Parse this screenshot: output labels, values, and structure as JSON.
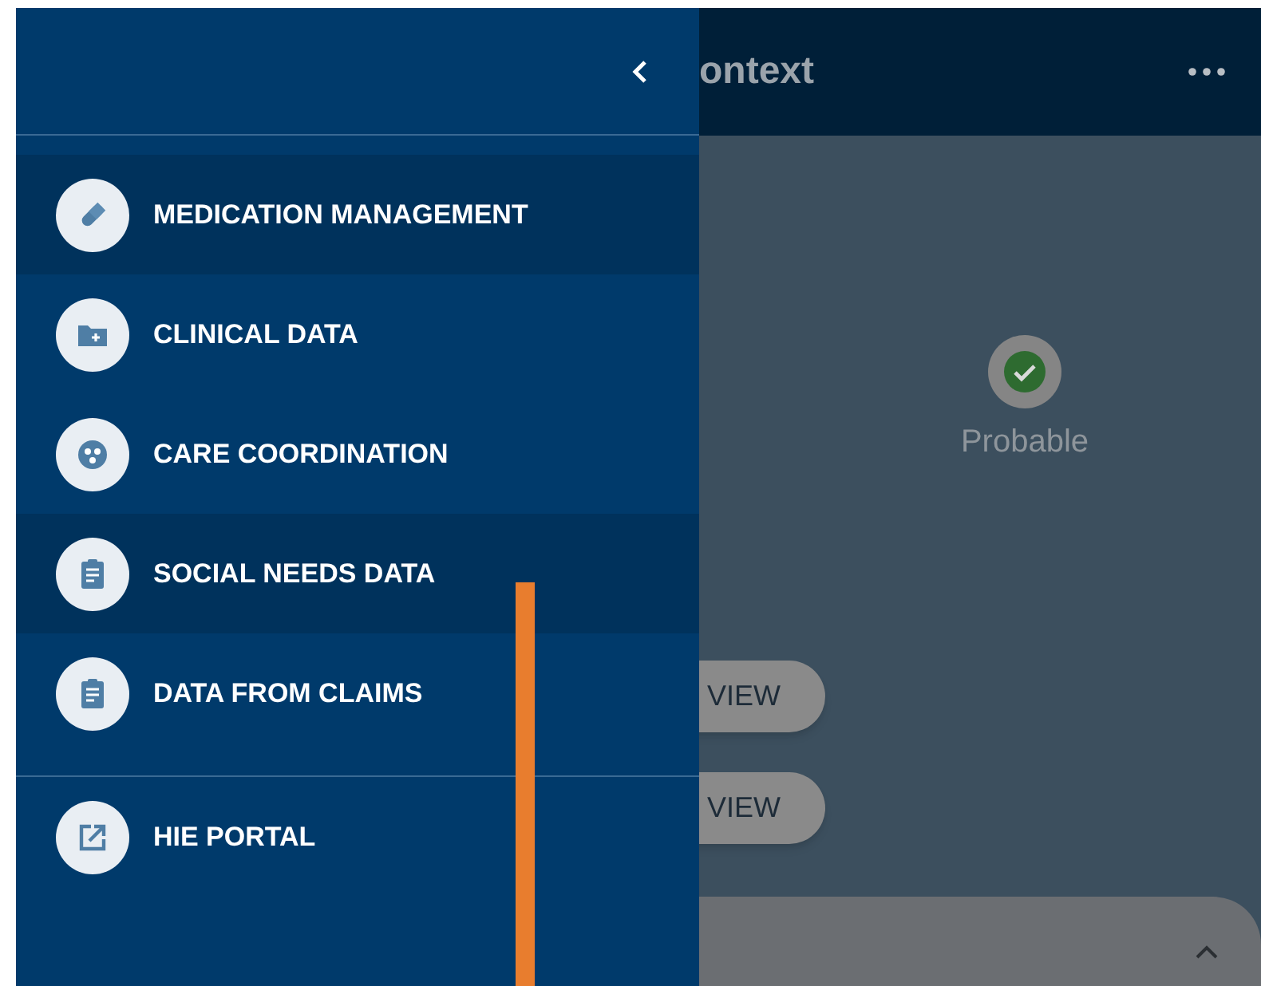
{
  "drawer": {
    "items": [
      {
        "label": "MEDICATION MANAGEMENT",
        "kind": "pill",
        "highlighted": true
      },
      {
        "label": "CLINICAL DATA",
        "kind": "folder-plus",
        "highlighted": false
      },
      {
        "label": "CARE COORDINATION",
        "kind": "people",
        "highlighted": false
      },
      {
        "label": "SOCIAL NEEDS DATA",
        "kind": "clipboard",
        "highlighted": true
      },
      {
        "label": "DATA FROM CLAIMS",
        "kind": "clipboard",
        "highlighted": false
      }
    ],
    "footer_items": [
      {
        "label": "HIE PORTAL",
        "kind": "external-link",
        "highlighted": false
      }
    ]
  },
  "page": {
    "title": "ontext",
    "status": {
      "label": "Probable"
    },
    "buttons": [
      "VIEW",
      "VIEW"
    ]
  }
}
